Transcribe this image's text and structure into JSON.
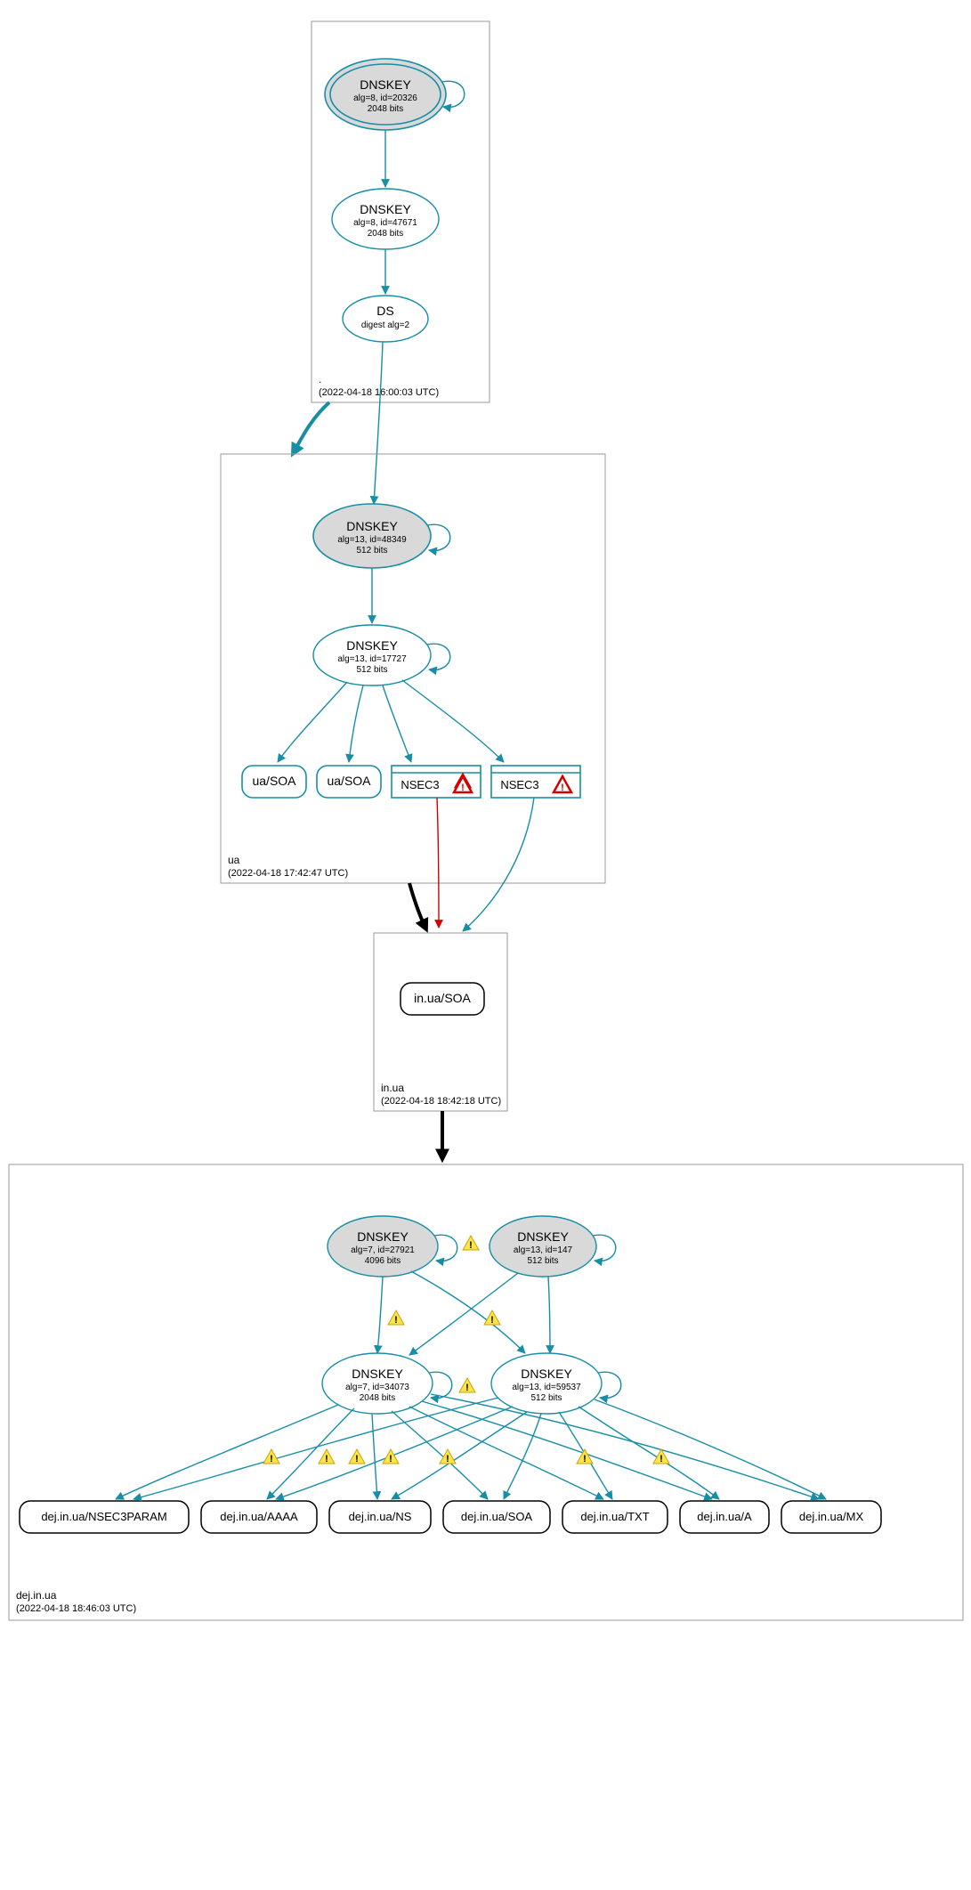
{
  "colors": {
    "teal": "#178ea5",
    "black": "#000000",
    "red": "#d40000",
    "grayFill": "#d9d9d9"
  },
  "zones": {
    "root": {
      "label": ".",
      "timestamp": "(2022-04-18 16:00:03 UTC)",
      "nodes": {
        "dnskey1": {
          "title": "DNSKEY",
          "line2": "alg=8, id=20326",
          "line3": "2048 bits"
        },
        "dnskey2": {
          "title": "DNSKEY",
          "line2": "alg=8, id=47671",
          "line3": "2048 bits"
        },
        "ds": {
          "title": "DS",
          "line2": "digest alg=2"
        }
      }
    },
    "ua": {
      "label": "ua",
      "timestamp": "(2022-04-18 17:42:47 UTC)",
      "nodes": {
        "dnskey1": {
          "title": "DNSKEY",
          "line2": "alg=13, id=48349",
          "line3": "512 bits"
        },
        "dnskey2": {
          "title": "DNSKEY",
          "line2": "alg=13, id=17727",
          "line3": "512 bits"
        },
        "soa1": {
          "title": "ua/SOA"
        },
        "soa2": {
          "title": "ua/SOA"
        },
        "nsec3a": {
          "title": "NSEC3"
        },
        "nsec3b": {
          "title": "NSEC3"
        }
      }
    },
    "inua": {
      "label": "in.ua",
      "timestamp": "(2022-04-18 18:42:18 UTC)",
      "nodes": {
        "soa": {
          "title": "in.ua/SOA"
        }
      }
    },
    "dej": {
      "label": "dej.in.ua",
      "timestamp": "(2022-04-18 18:46:03 UTC)",
      "nodes": {
        "dnskey1": {
          "title": "DNSKEY",
          "line2": "alg=7, id=27921",
          "line3": "4096 bits"
        },
        "dnskey2": {
          "title": "DNSKEY",
          "line2": "alg=13, id=147",
          "line3": "512 bits"
        },
        "dnskey3": {
          "title": "DNSKEY",
          "line2": "alg=7, id=34073",
          "line3": "2048 bits"
        },
        "dnskey4": {
          "title": "DNSKEY",
          "line2": "alg=13, id=59537",
          "line3": "512 bits"
        },
        "rr_nsec3p": {
          "title": "dej.in.ua/NSEC3PARAM"
        },
        "rr_aaaa": {
          "title": "dej.in.ua/AAAA"
        },
        "rr_ns": {
          "title": "dej.in.ua/NS"
        },
        "rr_soa": {
          "title": "dej.in.ua/SOA"
        },
        "rr_txt": {
          "title": "dej.in.ua/TXT"
        },
        "rr_a": {
          "title": "dej.in.ua/A"
        },
        "rr_mx": {
          "title": "dej.in.ua/MX"
        }
      }
    }
  }
}
